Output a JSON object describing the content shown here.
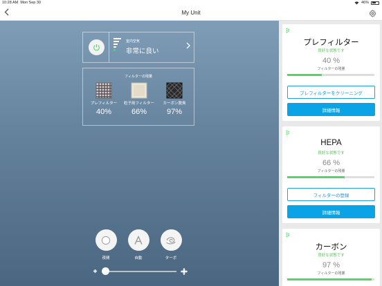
{
  "status_bar": {
    "time": "10:28 AM",
    "date": "Mon Sep 30",
    "battery": "46%"
  },
  "nav": {
    "back_icon": "chevron-left-icon",
    "title": "My Unit",
    "settings_icon": "gear-icon"
  },
  "air_quality": {
    "label": "室内空気",
    "value": "非常に良い"
  },
  "filters_summary": {
    "title": "フィルターの残量",
    "items": [
      {
        "name": "プレフィルター",
        "percent": "40%"
      },
      {
        "name": "粒子用フィルター",
        "percent": "66%"
      },
      {
        "name": "カーボン脱臭",
        "percent": "97%"
      }
    ]
  },
  "modes": [
    {
      "label": "夜間",
      "icon": "moon-icon"
    },
    {
      "label": "自動",
      "icon": "auto-a-icon"
    },
    {
      "label": "ターボ",
      "icon": "turbo-icon"
    }
  ],
  "fan_speed": {
    "level": 0,
    "min_icon": "fan-small-icon",
    "max_icon": "fan-large-icon"
  },
  "filter_cards": [
    {
      "title": "プレフィルター",
      "status": "良好な状態です",
      "percent": "40 %",
      "remaining_label": "フィルターの残量",
      "level": 0.4,
      "action_label": "プレフィルターをクリーニング",
      "details_label": "詳細情報"
    },
    {
      "title": "HEPA",
      "status": "良好な状態です",
      "percent": "66 %",
      "remaining_label": "フィルターの残量",
      "level": 0.66,
      "action_label": "フィルターの登録",
      "details_label": "詳細情報"
    },
    {
      "title": "カーボン",
      "status": "良好な状態です",
      "percent": "97 %",
      "remaining_label": "フィルターの残量",
      "level": 0.97
    }
  ],
  "colors": {
    "accent": "#0aa4e6",
    "good": "#4cd964",
    "background_top": "#7f9db7",
    "background_bottom": "#4a6680"
  }
}
